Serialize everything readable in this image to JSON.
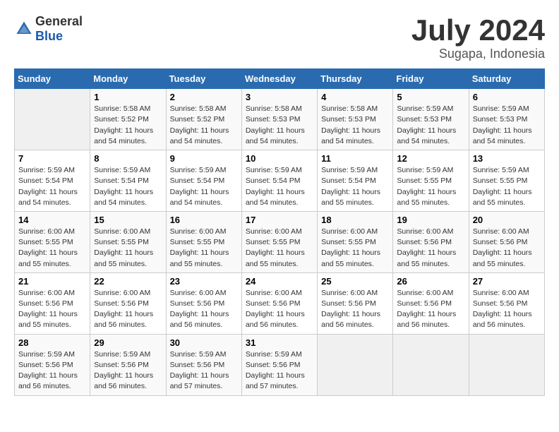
{
  "header": {
    "logo_general": "General",
    "logo_blue": "Blue",
    "title": "July 2024",
    "subtitle": "Sugapa, Indonesia"
  },
  "calendar": {
    "days_of_week": [
      "Sunday",
      "Monday",
      "Tuesday",
      "Wednesday",
      "Thursday",
      "Friday",
      "Saturday"
    ],
    "weeks": [
      [
        {
          "day": "",
          "info": ""
        },
        {
          "day": "1",
          "info": "Sunrise: 5:58 AM\nSunset: 5:52 PM\nDaylight: 11 hours\nand 54 minutes."
        },
        {
          "day": "2",
          "info": "Sunrise: 5:58 AM\nSunset: 5:52 PM\nDaylight: 11 hours\nand 54 minutes."
        },
        {
          "day": "3",
          "info": "Sunrise: 5:58 AM\nSunset: 5:53 PM\nDaylight: 11 hours\nand 54 minutes."
        },
        {
          "day": "4",
          "info": "Sunrise: 5:58 AM\nSunset: 5:53 PM\nDaylight: 11 hours\nand 54 minutes."
        },
        {
          "day": "5",
          "info": "Sunrise: 5:59 AM\nSunset: 5:53 PM\nDaylight: 11 hours\nand 54 minutes."
        },
        {
          "day": "6",
          "info": "Sunrise: 5:59 AM\nSunset: 5:53 PM\nDaylight: 11 hours\nand 54 minutes."
        }
      ],
      [
        {
          "day": "7",
          "info": "Sunrise: 5:59 AM\nSunset: 5:54 PM\nDaylight: 11 hours\nand 54 minutes."
        },
        {
          "day": "8",
          "info": "Sunrise: 5:59 AM\nSunset: 5:54 PM\nDaylight: 11 hours\nand 54 minutes."
        },
        {
          "day": "9",
          "info": "Sunrise: 5:59 AM\nSunset: 5:54 PM\nDaylight: 11 hours\nand 54 minutes."
        },
        {
          "day": "10",
          "info": "Sunrise: 5:59 AM\nSunset: 5:54 PM\nDaylight: 11 hours\nand 54 minutes."
        },
        {
          "day": "11",
          "info": "Sunrise: 5:59 AM\nSunset: 5:54 PM\nDaylight: 11 hours\nand 55 minutes."
        },
        {
          "day": "12",
          "info": "Sunrise: 5:59 AM\nSunset: 5:55 PM\nDaylight: 11 hours\nand 55 minutes."
        },
        {
          "day": "13",
          "info": "Sunrise: 5:59 AM\nSunset: 5:55 PM\nDaylight: 11 hours\nand 55 minutes."
        }
      ],
      [
        {
          "day": "14",
          "info": "Sunrise: 6:00 AM\nSunset: 5:55 PM\nDaylight: 11 hours\nand 55 minutes."
        },
        {
          "day": "15",
          "info": "Sunrise: 6:00 AM\nSunset: 5:55 PM\nDaylight: 11 hours\nand 55 minutes."
        },
        {
          "day": "16",
          "info": "Sunrise: 6:00 AM\nSunset: 5:55 PM\nDaylight: 11 hours\nand 55 minutes."
        },
        {
          "day": "17",
          "info": "Sunrise: 6:00 AM\nSunset: 5:55 PM\nDaylight: 11 hours\nand 55 minutes."
        },
        {
          "day": "18",
          "info": "Sunrise: 6:00 AM\nSunset: 5:55 PM\nDaylight: 11 hours\nand 55 minutes."
        },
        {
          "day": "19",
          "info": "Sunrise: 6:00 AM\nSunset: 5:56 PM\nDaylight: 11 hours\nand 55 minutes."
        },
        {
          "day": "20",
          "info": "Sunrise: 6:00 AM\nSunset: 5:56 PM\nDaylight: 11 hours\nand 55 minutes."
        }
      ],
      [
        {
          "day": "21",
          "info": "Sunrise: 6:00 AM\nSunset: 5:56 PM\nDaylight: 11 hours\nand 55 minutes."
        },
        {
          "day": "22",
          "info": "Sunrise: 6:00 AM\nSunset: 5:56 PM\nDaylight: 11 hours\nand 56 minutes."
        },
        {
          "day": "23",
          "info": "Sunrise: 6:00 AM\nSunset: 5:56 PM\nDaylight: 11 hours\nand 56 minutes."
        },
        {
          "day": "24",
          "info": "Sunrise: 6:00 AM\nSunset: 5:56 PM\nDaylight: 11 hours\nand 56 minutes."
        },
        {
          "day": "25",
          "info": "Sunrise: 6:00 AM\nSunset: 5:56 PM\nDaylight: 11 hours\nand 56 minutes."
        },
        {
          "day": "26",
          "info": "Sunrise: 6:00 AM\nSunset: 5:56 PM\nDaylight: 11 hours\nand 56 minutes."
        },
        {
          "day": "27",
          "info": "Sunrise: 6:00 AM\nSunset: 5:56 PM\nDaylight: 11 hours\nand 56 minutes."
        }
      ],
      [
        {
          "day": "28",
          "info": "Sunrise: 5:59 AM\nSunset: 5:56 PM\nDaylight: 11 hours\nand 56 minutes."
        },
        {
          "day": "29",
          "info": "Sunrise: 5:59 AM\nSunset: 5:56 PM\nDaylight: 11 hours\nand 56 minutes."
        },
        {
          "day": "30",
          "info": "Sunrise: 5:59 AM\nSunset: 5:56 PM\nDaylight: 11 hours\nand 57 minutes."
        },
        {
          "day": "31",
          "info": "Sunrise: 5:59 AM\nSunset: 5:56 PM\nDaylight: 11 hours\nand 57 minutes."
        },
        {
          "day": "",
          "info": ""
        },
        {
          "day": "",
          "info": ""
        },
        {
          "day": "",
          "info": ""
        }
      ]
    ]
  }
}
